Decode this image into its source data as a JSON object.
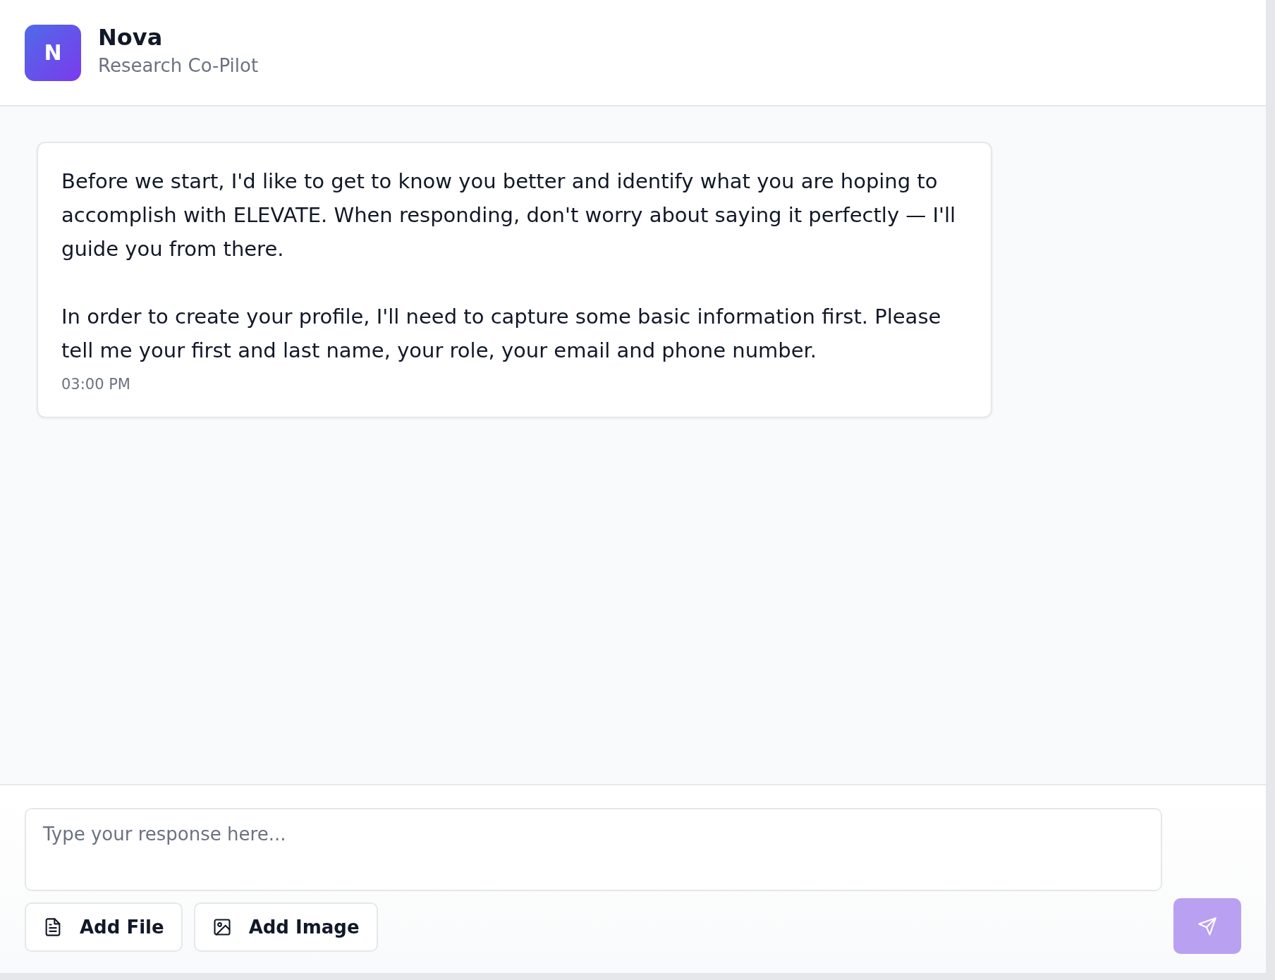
{
  "header": {
    "avatar_letter": "N",
    "title": "Nova",
    "subtitle": "Research Co-Pilot"
  },
  "messages": [
    {
      "paragraphs": [
        "Before we start, I'd like to get to know you better and identify what you are hoping to accomplish with ELEVATE. When responding, don't worry about saying it perfectly — I'll guide you from there.",
        "In order to create your profile, I'll need to capture some basic information first. Please tell me your first and last name, your role, your email and phone number."
      ],
      "time": "03:00 PM"
    }
  ],
  "composer": {
    "placeholder": "Type your response here...",
    "buttons": [
      {
        "kind": "file",
        "label": "Add File"
      },
      {
        "kind": "image",
        "label": "Add Image"
      }
    ],
    "send_disabled": true
  }
}
